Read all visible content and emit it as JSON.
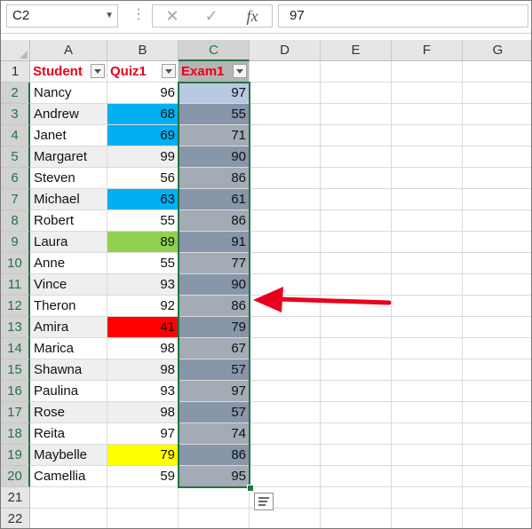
{
  "formula_bar": {
    "name_box": "C2",
    "cancel_icon": "✕",
    "enter_icon": "✓",
    "function_label": "fx",
    "value": "97"
  },
  "columns": [
    "A",
    "B",
    "C",
    "D",
    "E",
    "F",
    "G"
  ],
  "selected_column": "C",
  "rows": [
    "1",
    "2",
    "3",
    "4",
    "5",
    "6",
    "7",
    "8",
    "9",
    "10",
    "11",
    "12",
    "13",
    "14",
    "15",
    "16",
    "17",
    "18",
    "19",
    "20",
    "21",
    "22"
  ],
  "headers": {
    "student": "Student",
    "quiz": "Quiz1",
    "exam": "Exam1"
  },
  "records": [
    {
      "name": "Nancy",
      "quiz": "96",
      "exam": "97"
    },
    {
      "name": "Andrew",
      "quiz": "68",
      "exam": "55"
    },
    {
      "name": "Janet",
      "quiz": "69",
      "exam": "71"
    },
    {
      "name": "Margaret",
      "quiz": "99",
      "exam": "90"
    },
    {
      "name": "Steven",
      "quiz": "56",
      "exam": "86"
    },
    {
      "name": "Michael",
      "quiz": "63",
      "exam": "61"
    },
    {
      "name": "Robert",
      "quiz": "55",
      "exam": "86"
    },
    {
      "name": "Laura",
      "quiz": "89",
      "exam": "91"
    },
    {
      "name": "Anne",
      "quiz": "55",
      "exam": "77"
    },
    {
      "name": "Vince",
      "quiz": "93",
      "exam": "90"
    },
    {
      "name": "Theron",
      "quiz": "92",
      "exam": "86"
    },
    {
      "name": "Amira",
      "quiz": "41",
      "exam": "79"
    },
    {
      "name": "Marica",
      "quiz": "98",
      "exam": "67"
    },
    {
      "name": "Shawna",
      "quiz": "98",
      "exam": "57"
    },
    {
      "name": "Paulina",
      "quiz": "93",
      "exam": "97"
    },
    {
      "name": "Rose",
      "quiz": "98",
      "exam": "57"
    },
    {
      "name": "Reita",
      "quiz": "97",
      "exam": "74"
    },
    {
      "name": "Maybelle",
      "quiz": "79",
      "exam": "86"
    },
    {
      "name": "Camellia",
      "quiz": "59",
      "exam": "95"
    }
  ],
  "quiz_fill_colors": {
    "Andrew": "#00b0f0",
    "Janet": "#00b0f0",
    "Michael": "#00b0f0",
    "Laura": "#92d050",
    "Amira": "#ff0000",
    "Maybelle": "#ffff00"
  },
  "colors": {
    "accent_green": "#217346",
    "header_text_red": "#e8001c",
    "row_band_fill": "#efefef",
    "exam_fill_light": "#a3abb5",
    "exam_fill_dark": "#8896aa",
    "exam_fill_active": "#b8c9e1",
    "arrow_red": "#e8001c"
  },
  "icons": {
    "quick_analysis": "quick-analysis-icon",
    "filter": "filter-dropdown-icon",
    "annotation": "red-arrow-icon"
  }
}
